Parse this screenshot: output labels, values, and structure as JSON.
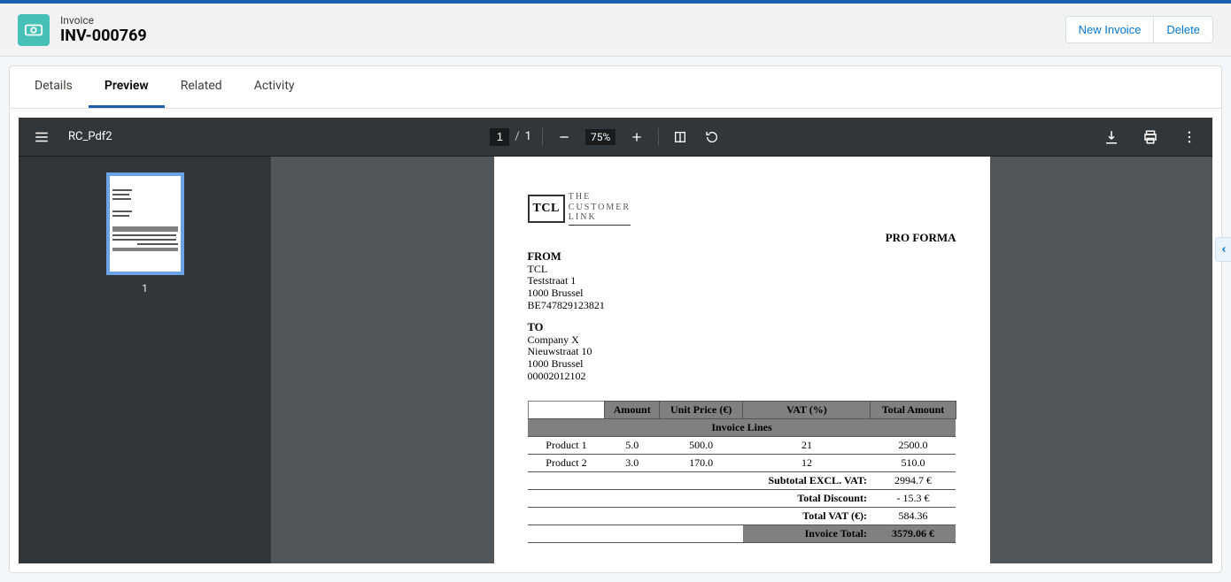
{
  "header": {
    "label": "Invoice",
    "title": "INV-000769",
    "new_label": "New Invoice",
    "delete_label": "Delete"
  },
  "tabs": [
    "Details",
    "Preview",
    "Related",
    "Activity"
  ],
  "active_tab_index": 1,
  "pdf": {
    "filename": "RC_Pdf2",
    "page_current": "1",
    "page_total": "1",
    "zoom": "75%",
    "thumb_label": "1"
  },
  "doc": {
    "logo_abbr": "TCL",
    "logo_lines": [
      "THE",
      "CUSTOMER",
      "LINK"
    ],
    "doc_type": "PRO FORMA",
    "from_label": "FROM",
    "from": {
      "company": "TCL",
      "street": "Teststraat 1",
      "city": "1000 Brussel",
      "vat": "BE747829123821"
    },
    "to_label": "TO",
    "to": {
      "company": "Company X",
      "street": "Nieuwstraat 10",
      "city": "1000 Brussel",
      "vat": "00002012102"
    },
    "table": {
      "headers": [
        "",
        "Amount",
        "Unit Price (€)",
        "VAT (%)",
        "Total Amount"
      ],
      "section": "Invoice Lines",
      "rows": [
        {
          "name": "Product 1",
          "amount": "5.0",
          "unit": "500.0",
          "vat": "21",
          "total": "2500.0"
        },
        {
          "name": "Product 2",
          "amount": "3.0",
          "unit": "170.0",
          "vat": "12",
          "total": "510.0"
        }
      ],
      "summary": [
        {
          "label": "Subtotal EXCL. VAT:",
          "value": "2994.7 €"
        },
        {
          "label": "Total Discount:",
          "value": "- 15.3 €"
        },
        {
          "label": "Total VAT (€):",
          "value": "584.36"
        }
      ],
      "grand": {
        "label": "Invoice Total:",
        "value": "3579.06 €"
      }
    }
  }
}
